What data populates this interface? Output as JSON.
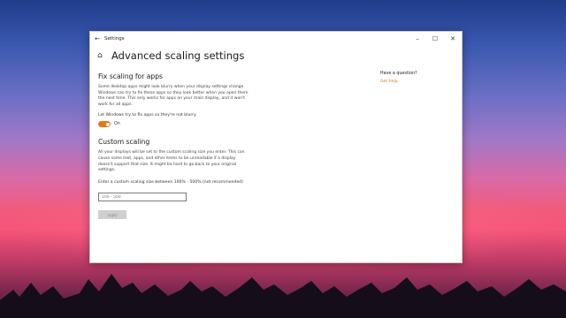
{
  "window": {
    "title": "Settings",
    "back_icon": "back-arrow-icon",
    "controls": {
      "minimize": "–",
      "maximize": "☐",
      "close": "✕"
    }
  },
  "page": {
    "title": "Advanced scaling settings",
    "home_icon": "home-icon"
  },
  "fix_scaling": {
    "heading": "Fix scaling for apps",
    "description": "Some desktop apps might look blurry when your display settings change. Windows can try to fix these apps so they look better when you open them the next time. This only works for apps on your main display, and it won't work for all apps.",
    "toggle_label": "Let Windows try to fix apps so they're not blurry",
    "toggle_state": "On",
    "toggle_on": true
  },
  "custom_scaling": {
    "heading": "Custom scaling",
    "description": "All your displays will be set to the custom scaling size you enter. This can cause some text, apps, and other items to be unreadable if a display doesn't support that size. It might be hard to go back to your original settings.",
    "input_label": "Enter a custom scaling size between 100% - 500% (not recommended)",
    "input_placeholder": "100 - 500",
    "apply_label": "Apply"
  },
  "aside": {
    "question": "Have a question?",
    "link": "Get help"
  },
  "colors": {
    "accent": "#e07b1d",
    "link": "#d37a00"
  }
}
